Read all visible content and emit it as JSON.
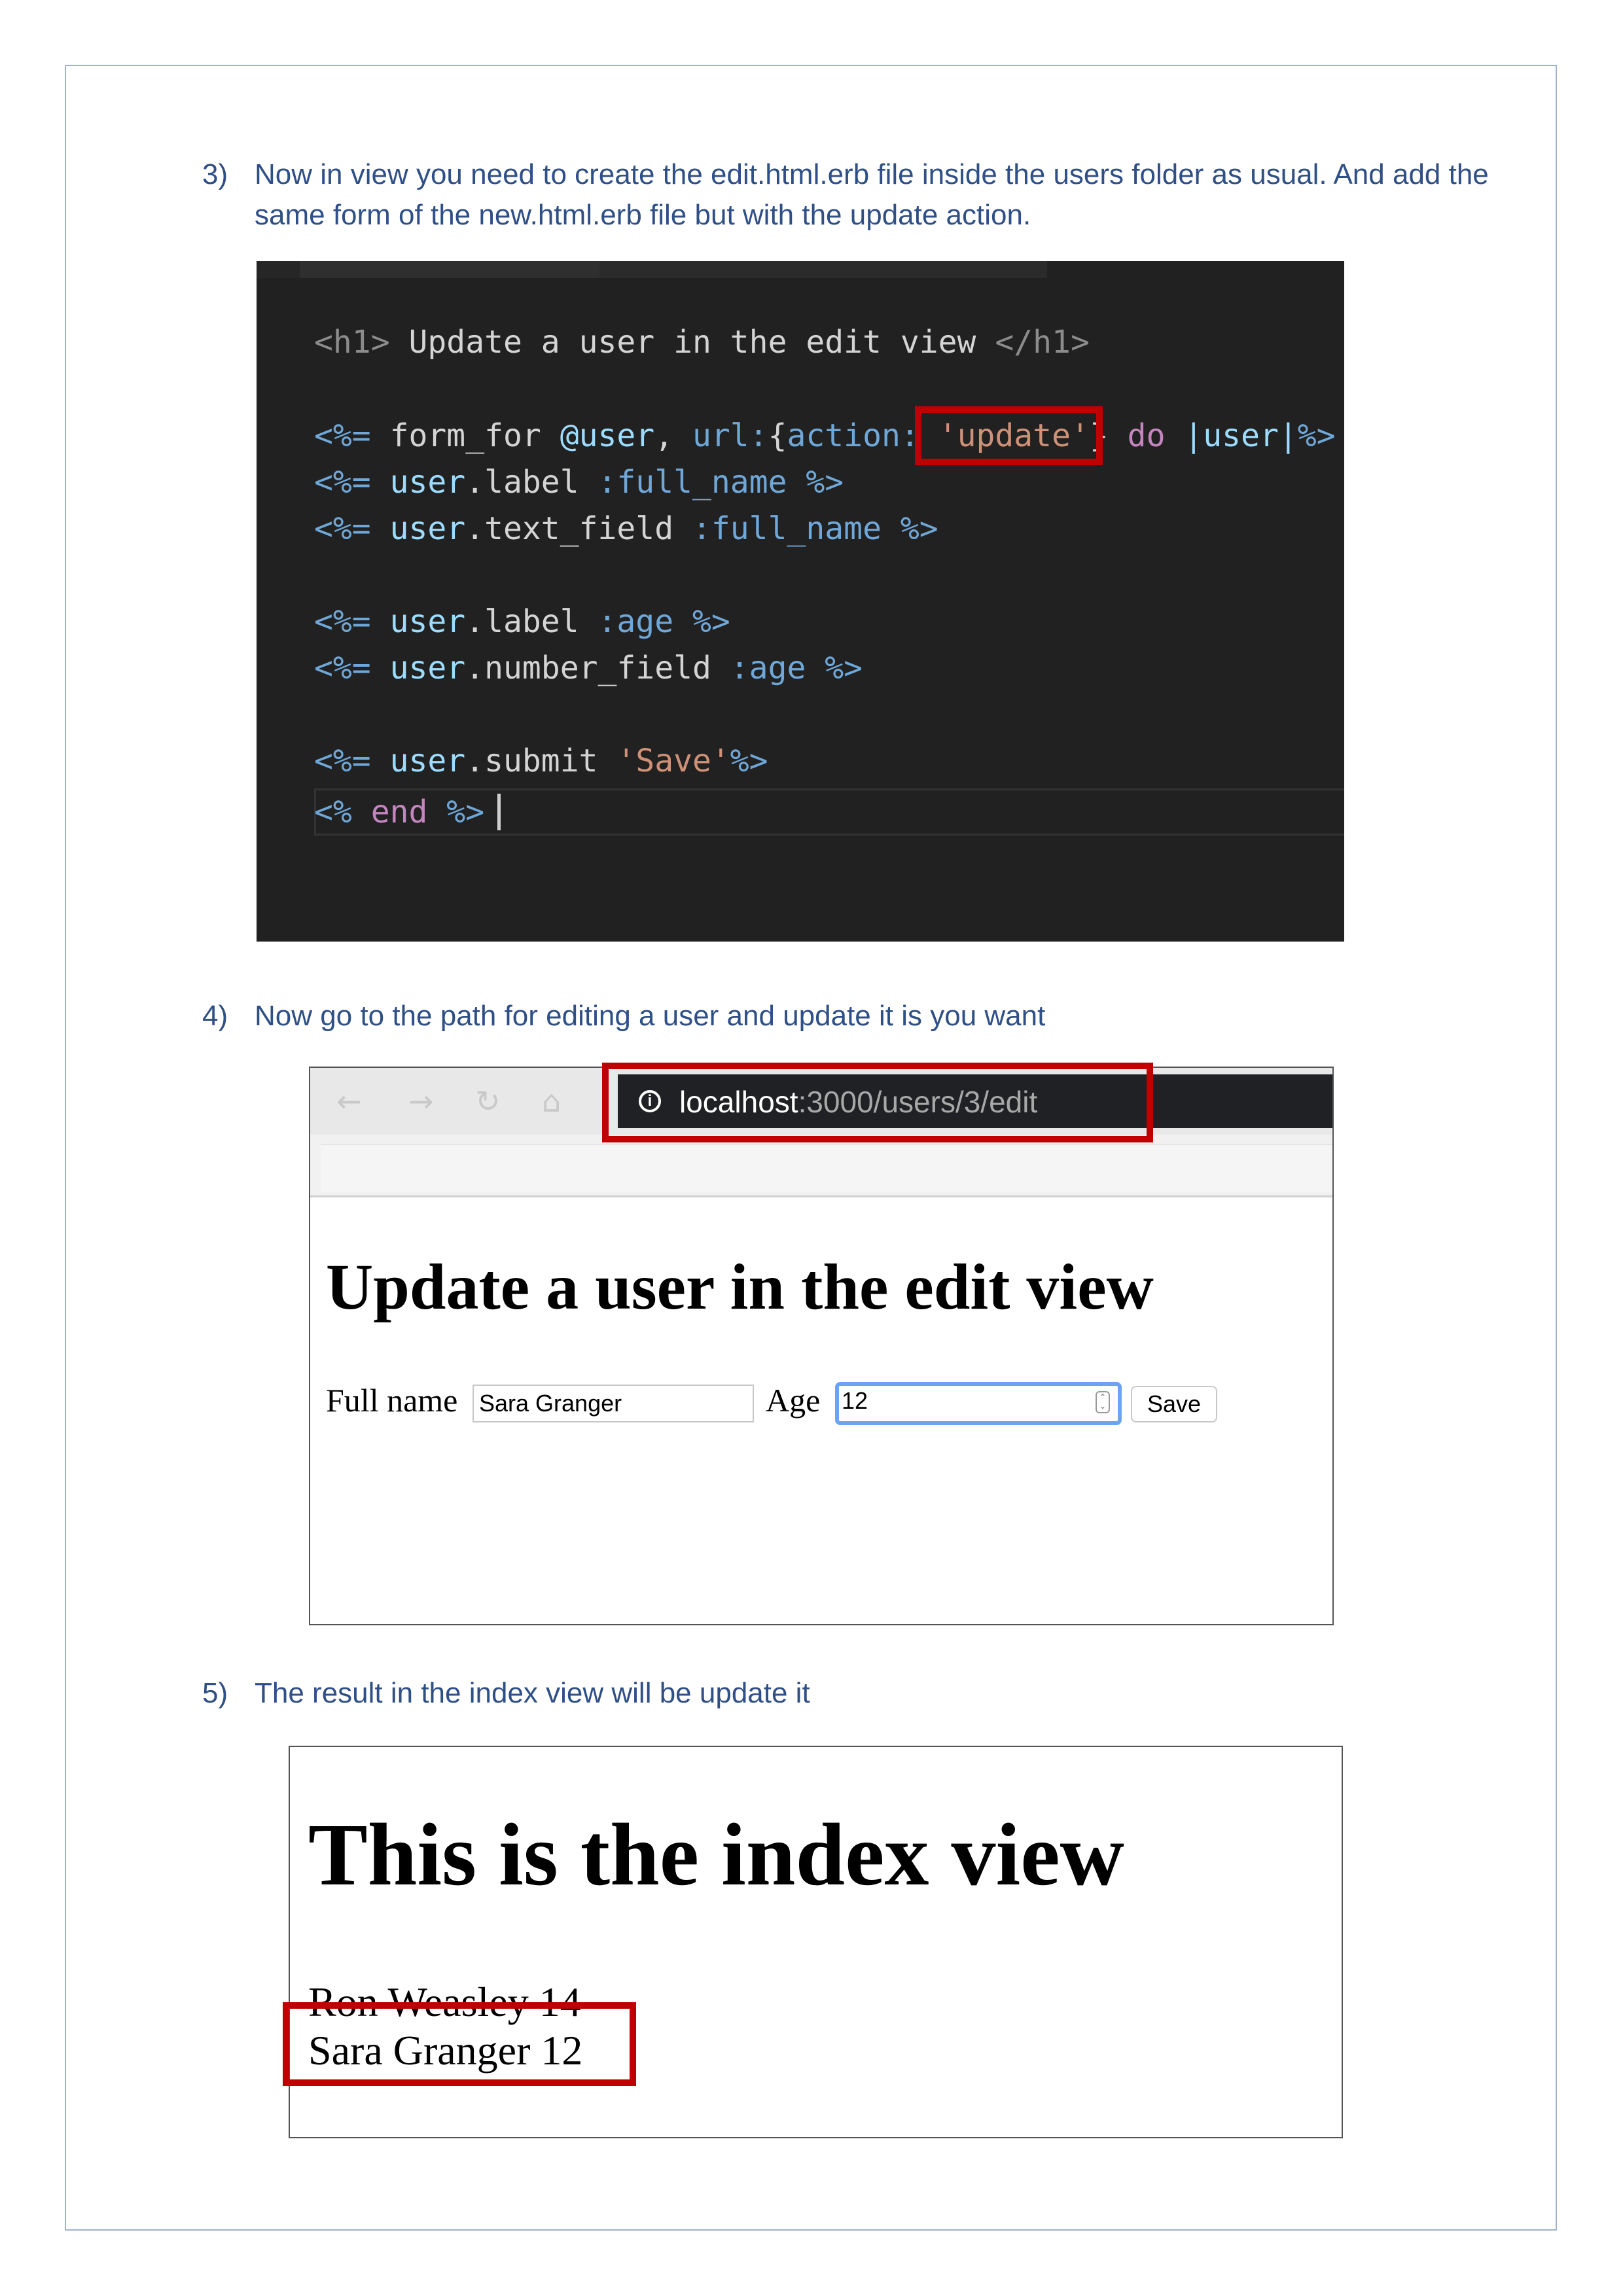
{
  "steps": [
    {
      "number": "3)",
      "text": "Now in view you need to create the edit.html.erb file inside the users folder as usual. And add the same form of the new.html.erb file but with the update action."
    },
    {
      "number": "4)",
      "text": "Now go to the path for editing a user and update it is you want"
    },
    {
      "number": "5)",
      "text": "The result in the index view will be update it"
    }
  ],
  "code": {
    "h1_open": "<h1>",
    "h1_text": " Update a user in the edit view ",
    "h1_close": "</h1>",
    "form_open": "<%=",
    "form_for": " form_for ",
    "at_user": "@user",
    "comma_url": ", ",
    "url_key": "url:",
    "brace_open": "{",
    "action_key": "action:",
    "space": " ",
    "update_str": "'update'",
    "brace_close": "}",
    "do_kw": " do ",
    "pipe_user": "|user|",
    "form_close": "%>",
    "label1_open": "<%=",
    "label1_user": " user",
    "label1_method": ".label ",
    "label1_sym": ":full_name",
    "label1_close": " %>",
    "text_open": "<%=",
    "text_user": " user",
    "text_method": ".text_field ",
    "text_sym": ":full_name",
    "text_close": " %>",
    "label2_open": "<%=",
    "label2_user": " user",
    "label2_method": ".label ",
    "label2_sym": ":age",
    "label2_close": " %>",
    "number_open": "<%=",
    "number_user": " user",
    "number_method": ".number_field ",
    "number_sym": ":age",
    "number_close": " %>",
    "submit_open": "<%=",
    "submit_user": " user",
    "submit_method": ".submit ",
    "submit_str": "'Save'",
    "submit_close": "%>",
    "end_open": "<%",
    "end_kw": " end ",
    "end_close": "%>"
  },
  "browser": {
    "url_host": "localhost",
    "url_rest": ":3000/users/3/edit",
    "heading": "Update a user in the edit view",
    "full_name_label": "Full name",
    "full_name_value": "Sara Granger",
    "age_label": "Age",
    "age_value": "12",
    "save_label": "Save",
    "icons": [
      "back-arrow",
      "forward-arrow",
      "reload",
      "home",
      "info"
    ]
  },
  "index_view": {
    "heading": "This is the index view",
    "rows": [
      "Ron Weasley 14",
      "Sara Granger 12"
    ]
  },
  "colors": {
    "step_text": "#2f4f87",
    "highlight": "#c00000",
    "editor_bg": "#212121",
    "focus_ring": "#6ea3f4"
  }
}
